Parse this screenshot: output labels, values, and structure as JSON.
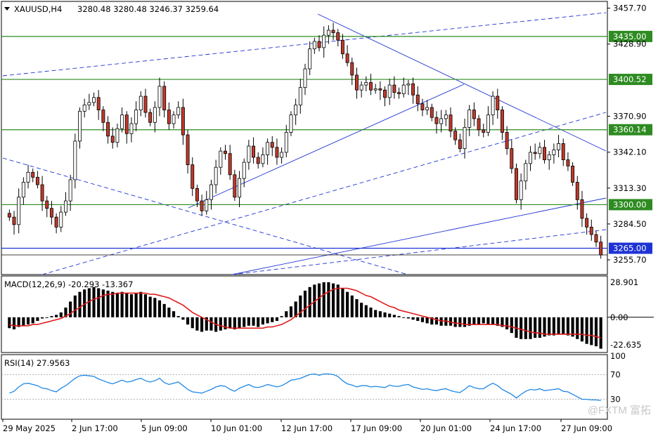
{
  "header": {
    "symbol": "XAUUSD,H4",
    "ohlc": "3280.48 3280.48 3246.37 3259.64"
  },
  "colors": {
    "bull": "#ffffff",
    "bear": "#c0392b",
    "candle_border": "#000000",
    "hline": "#2e8b22",
    "blue": "#1f33d4",
    "macd_signal": "#e01b1b",
    "rsi": "#1e88e5"
  },
  "chart_data": [
    {
      "type": "candlestick",
      "symbol": "XAUUSD",
      "timeframe": "H4",
      "ylim": [
        3245.0,
        3462.0
      ],
      "y_ticks": [
        3457.7,
        3428.9,
        3370.9,
        3342.1,
        3313.3,
        3284.5,
        3255.7
      ],
      "x_tick_labels": [
        "29 May 2025",
        "2 Jun 17:00",
        "5 Jun 09:00",
        "10 Jun 01:00",
        "12 Jun 17:00",
        "17 Jun 09:00",
        "20 Jun 01:00",
        "24 Jun 17:00",
        "27 Jun 09:00"
      ],
      "horizontal_levels": [
        {
          "label": "3435.00",
          "value": 3435.0,
          "kind": "green"
        },
        {
          "label": "3400.52",
          "value": 3400.52,
          "kind": "green"
        },
        {
          "label": "3360.14",
          "value": 3360.14,
          "kind": "green"
        },
        {
          "label": "3300.00",
          "value": 3300.0,
          "kind": "green"
        },
        {
          "label": "3265.00",
          "value": 3265.0,
          "kind": "blue"
        }
      ],
      "current_price": 3259.64,
      "closes": [
        3290,
        3284,
        3306,
        3318,
        3326,
        3322,
        3316,
        3303,
        3297,
        3290,
        3282,
        3294,
        3303,
        3320,
        3351,
        3375,
        3380,
        3382,
        3386,
        3376,
        3366,
        3355,
        3350,
        3361,
        3372,
        3357,
        3365,
        3376,
        3387,
        3374,
        3366,
        3378,
        3395,
        3376,
        3365,
        3372,
        3378,
        3356,
        3332,
        3313,
        3303,
        3295,
        3304,
        3316,
        3330,
        3343,
        3341,
        3324,
        3306,
        3321,
        3334,
        3347,
        3338,
        3333,
        3340,
        3350,
        3346,
        3338,
        3342,
        3358,
        3372,
        3380,
        3394,
        3409,
        3425,
        3431,
        3426,
        3436,
        3440,
        3438,
        3432,
        3421,
        3414,
        3404,
        3392,
        3396,
        3398,
        3392,
        3393,
        3392,
        3386,
        3396,
        3390,
        3389,
        3396,
        3397,
        3388,
        3381,
        3376,
        3378,
        3370,
        3365,
        3369,
        3372,
        3359,
        3352,
        3345,
        3362,
        3376,
        3369,
        3360,
        3358,
        3372,
        3387,
        3376,
        3358,
        3345,
        3329,
        3304,
        3319,
        3333,
        3342,
        3341,
        3346,
        3336,
        3340,
        3344,
        3349,
        3336,
        3331,
        3318,
        3304,
        3289,
        3282,
        3276,
        3270,
        3259.64
      ],
      "macd": {
        "label": "MACD(12,26,9) -20.293 -13.367",
        "ylim": [
          -28,
          33
        ],
        "y_ticks": [
          28.901,
          0.0,
          -22.635
        ],
        "histogram": [
          -9,
          -10,
          -8,
          -7,
          -6,
          -5,
          -3,
          -1,
          0,
          1,
          2,
          4,
          8,
          13,
          18,
          21,
          23,
          24,
          25,
          24,
          23,
          22,
          21,
          20,
          21,
          20,
          19,
          20,
          21,
          19,
          17,
          16,
          14,
          11,
          8,
          5,
          1,
          -2,
          -6,
          -9,
          -11,
          -12,
          -11,
          -11,
          -12,
          -11,
          -10,
          -9,
          -10,
          -9,
          -8,
          -7,
          -7,
          -8,
          -6,
          -5,
          -4,
          -3,
          1,
          5,
          9,
          13,
          18,
          22,
          25,
          27,
          28,
          29,
          29,
          28,
          27,
          24,
          21,
          18,
          15,
          12,
          10,
          8,
          6,
          5,
          4,
          3,
          2,
          1,
          0,
          -1,
          -2,
          -3,
          -4,
          -5,
          -6,
          -6,
          -7,
          -7,
          -7,
          -8,
          -8,
          -8,
          -7,
          -6,
          -6,
          -5,
          -6,
          -6,
          -7,
          -8,
          -10,
          -13,
          -17,
          -18,
          -18,
          -18,
          -17,
          -17,
          -16,
          -15,
          -15,
          -14,
          -14,
          -15,
          -16,
          -18,
          -20,
          -22,
          -23,
          -24,
          -26
        ],
        "signal": [
          -6,
          -7,
          -7,
          -7,
          -7,
          -6,
          -6,
          -5,
          -4,
          -3,
          -2,
          -1,
          1,
          3,
          6,
          8,
          11,
          13,
          15,
          16,
          18,
          19,
          19,
          20,
          20,
          20,
          20,
          20,
          20,
          20,
          19,
          19,
          18,
          17,
          16,
          14,
          12,
          10,
          7,
          4,
          2,
          0,
          -2,
          -4,
          -6,
          -7,
          -8,
          -9,
          -9,
          -9,
          -9,
          -9,
          -9,
          -9,
          -9,
          -8,
          -8,
          -7,
          -6,
          -4,
          -2,
          1,
          4,
          7,
          10,
          13,
          16,
          19,
          21,
          23,
          24,
          24,
          24,
          23,
          22,
          20,
          18,
          17,
          15,
          13,
          11,
          9,
          8,
          6,
          5,
          4,
          3,
          2,
          1,
          0,
          -1,
          -2,
          -3,
          -3,
          -4,
          -5,
          -5,
          -6,
          -6,
          -6,
          -6,
          -6,
          -6,
          -6,
          -6,
          -7,
          -7,
          -8,
          -9,
          -10,
          -11,
          -12,
          -13,
          -13,
          -14,
          -14,
          -14,
          -14,
          -14,
          -14,
          -14,
          -14,
          -14,
          -15,
          -15,
          -16,
          -17
        ]
      },
      "rsi": {
        "label": "RSI(14) 27.9563",
        "ylim": [
          0,
          100
        ],
        "y_ticks": [
          100,
          70,
          30
        ],
        "levels": [
          70,
          30
        ],
        "values": [
          40,
          43,
          50,
          55,
          56,
          54,
          52,
          48,
          47,
          44,
          42,
          48,
          52,
          58,
          64,
          68,
          69,
          68,
          67,
          63,
          60,
          57,
          55,
          58,
          61,
          58,
          59,
          62,
          64,
          60,
          58,
          60,
          64,
          57,
          54,
          56,
          58,
          52,
          46,
          42,
          41,
          40,
          43,
          46,
          50,
          52,
          51,
          46,
          43,
          48,
          51,
          54,
          50,
          49,
          51,
          54,
          52,
          50,
          52,
          56,
          61,
          62,
          64,
          67,
          70,
          71,
          69,
          71,
          71,
          70,
          67,
          60,
          55,
          53,
          50,
          52,
          52,
          50,
          51,
          50,
          49,
          53,
          51,
          51,
          53,
          54,
          50,
          48,
          46,
          47,
          45,
          44,
          46,
          47,
          44,
          42,
          41,
          46,
          52,
          49,
          47,
          47,
          52,
          56,
          52,
          46,
          42,
          38,
          32,
          38,
          43,
          46,
          45,
          47,
          44,
          45,
          46,
          47,
          43,
          42,
          38,
          34,
          30,
          30,
          29,
          29,
          27.9563
        ]
      }
    }
  ],
  "watermark": "@FXTM 富拓"
}
